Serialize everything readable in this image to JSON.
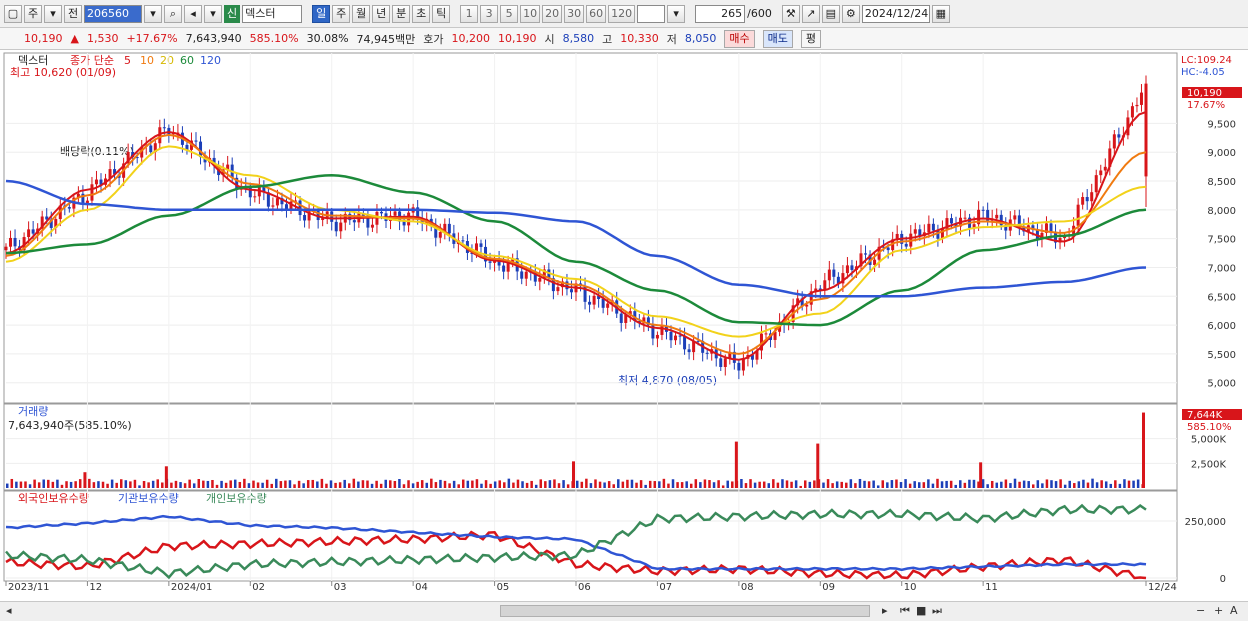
{
  "toolbar": {
    "type_label": "주",
    "prev_label": "전",
    "code": "206560",
    "market_badge": "신",
    "stock_name": "덱스터",
    "periods": [
      "일",
      "주",
      "월",
      "년",
      "분",
      "초",
      "틱"
    ],
    "active_period": "일",
    "intervals": [
      "1",
      "3",
      "5",
      "10",
      "20",
      "30",
      "60",
      "120"
    ],
    "count": "265",
    "count_total": "/600",
    "date": "2024/12/24"
  },
  "quote": {
    "price": "10,190",
    "direction": "▲",
    "change": "1,530",
    "change_pct": "+17.67%",
    "volume": "7,643,940",
    "volume_ratio": "585.10%",
    "turnover_pct": "30.08%",
    "amount": "74,945백만",
    "hoga_label": "호가",
    "ask": "10,200",
    "bid": "10,190",
    "open_label": "시",
    "open": "8,580",
    "high_label": "고",
    "high": "10,330",
    "low_label": "저",
    "low": "8,050",
    "buy_label": "매수",
    "sell_label": "매도",
    "eval_label": "평"
  },
  "colors": {
    "up": "#d8151a",
    "down": "#1c3fb8",
    "ma5": "#d8151a",
    "ma10": "#f07a10",
    "ma20": "#f2d21a",
    "ma60": "#1c8a3a",
    "ma120": "#2f55d4",
    "foreign": "#d8151a",
    "institution": "#2f55d4",
    "individual": "#3a8a5a"
  },
  "chart_data": [
    {
      "type": "line",
      "name": "price",
      "legend": {
        "title": "덱스터",
        "series_label": "종가 단순",
        "periods": [
          "5",
          "10",
          "20",
          "60",
          "120"
        ]
      },
      "x_ticks": [
        "2023/11",
        "2024/01",
        "02",
        "03",
        "04",
        "05",
        "06",
        "07",
        "08",
        "09",
        "10",
        "11",
        "12",
        "12/24"
      ],
      "y_ticks": [
        "9,500",
        "9,000",
        "8,500",
        "8,000",
        "7,500",
        "7,000",
        "6,500",
        "6,000",
        "5,500",
        "5,000"
      ],
      "ylim": [
        4700,
        10600
      ],
      "price_marker": {
        "price": "10,190",
        "pct": "17.67%"
      },
      "lc_label": "LC:109.24",
      "hc_label": "HC:-4.05",
      "annotations": {
        "high": "최고 10,620 (01/09)",
        "low": "최저 4,870 (08/05)",
        "dividend": "배당락(0.11%)"
      },
      "x_months": [
        "2023/11",
        "12",
        "2024/01",
        "02",
        "03",
        "04",
        "05",
        "06",
        "07",
        "08",
        "09",
        "10",
        "11",
        "12",
        "12/24"
      ],
      "close_monthly": [
        7300,
        8300,
        9400,
        8300,
        7800,
        7900,
        7100,
        6600,
        5900,
        5300,
        6700,
        7500,
        7900,
        7500,
        10190
      ],
      "series": [
        {
          "name": "5",
          "values": [
            7250,
            8350,
            9350,
            8350,
            7850,
            7880,
            7120,
            6650,
            5950,
            5400,
            6600,
            7500,
            7850,
            7450,
            9700
          ]
        },
        {
          "name": "10",
          "values": [
            7200,
            8250,
            9300,
            8450,
            7900,
            7850,
            7150,
            6700,
            6000,
            5500,
            6450,
            7450,
            7800,
            7600,
            9000
          ]
        },
        {
          "name": "20",
          "values": [
            7100,
            8000,
            9100,
            8600,
            8000,
            7800,
            7200,
            6800,
            6150,
            5800,
            6200,
            7300,
            7700,
            7800,
            8400
          ]
        },
        {
          "name": "60",
          "values": [
            7250,
            7400,
            7900,
            8400,
            8600,
            8300,
            7800,
            7100,
            6600,
            6050,
            6000,
            6600,
            7300,
            7550,
            8000
          ]
        },
        {
          "name": "120",
          "values": [
            8500,
            8100,
            8000,
            8000,
            8000,
            8000,
            7950,
            7800,
            7200,
            6700,
            6500,
            6500,
            6650,
            6750,
            7000
          ]
        }
      ]
    },
    {
      "type": "bar",
      "name": "volume",
      "title": "거래량",
      "value_label": "7,643,940주(585.10%)",
      "y_ticks": [
        "5,000K",
        "2,500K"
      ],
      "ylim": [
        0,
        7700
      ],
      "last_marker": {
        "value": "7,644K",
        "pct": "585.10%"
      },
      "spikes_k": [
        {
          "month_index": 1,
          "value": 1600
        },
        {
          "month_index": 2,
          "value": 2200
        },
        {
          "month_index": 7,
          "value": 2700
        },
        {
          "month_index": 9,
          "value": 4700
        },
        {
          "month_index": 10,
          "value": 4500
        },
        {
          "month_index": 12,
          "value": 2600
        },
        {
          "month_index": 14,
          "value": 7644
        }
      ]
    },
    {
      "type": "line",
      "name": "holdings",
      "series_labels": [
        "외국인보유수량",
        "기관보유수량",
        "개인보유수량"
      ],
      "y_ticks": [
        "250,000",
        "0"
      ],
      "series": [
        {
          "name": "외국인보유수량",
          "values": [
            70,
            50,
            140,
            150,
            160,
            170,
            190,
            60,
            30,
            40,
            20,
            10,
            50,
            80,
            0
          ]
        },
        {
          "name": "기관보유수량",
          "values": [
            220,
            240,
            270,
            230,
            220,
            200,
            180,
            170,
            40,
            40,
            40,
            40,
            50,
            60,
            60
          ]
        },
        {
          "name": "개인보유수량",
          "values": [
            100,
            80,
            20,
            60,
            70,
            80,
            90,
            100,
            260,
            270,
            280,
            280,
            260,
            300,
            300
          ]
        }
      ]
    }
  ]
}
